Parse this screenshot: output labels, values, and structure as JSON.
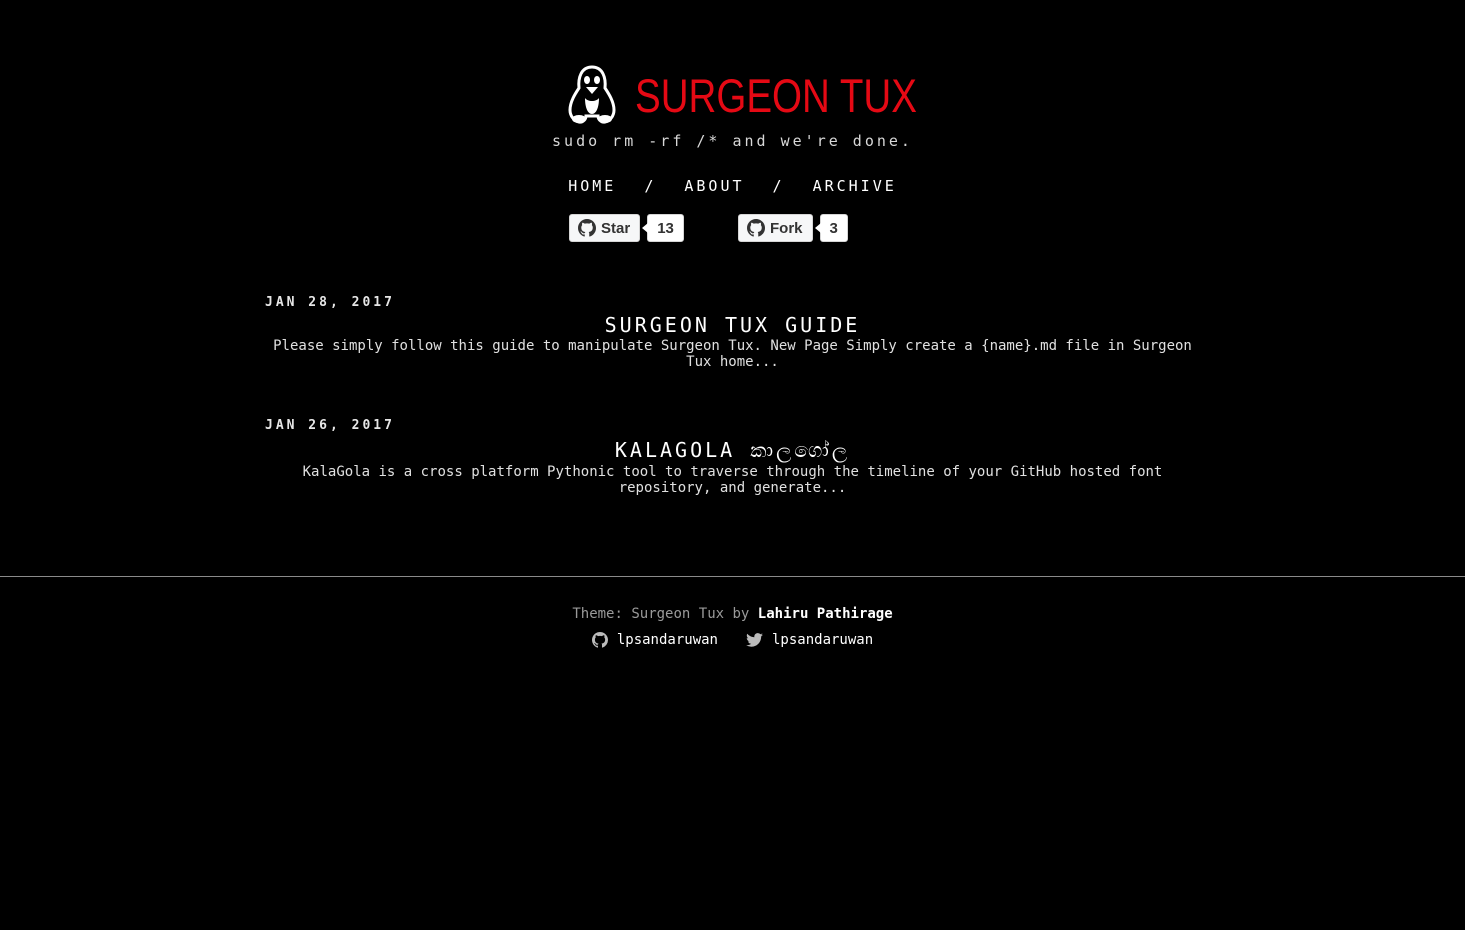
{
  "site": {
    "title": "SURGEON TUX",
    "tagline": "sudo rm -rf /* and we're done."
  },
  "nav": {
    "items": [
      {
        "label": "HOME"
      },
      {
        "label": "ABOUT"
      },
      {
        "label": "ARCHIVE"
      }
    ],
    "separator": "/"
  },
  "github_buttons": {
    "star": {
      "label": "Star",
      "count": "13"
    },
    "fork": {
      "label": "Fork",
      "count": "3"
    }
  },
  "posts": [
    {
      "date": "JAN 28, 2017",
      "title": "SURGEON TUX GUIDE",
      "excerpt": "Please simply follow this guide to manipulate Surgeon Tux. New Page Simply create a {name}.md file in Surgeon Tux home..."
    },
    {
      "date": "JAN 26, 2017",
      "title": "KALAGOLA කාලගෝල",
      "excerpt": "KalaGola is a cross platform Pythonic tool to traverse through the timeline of your GitHub hosted font repository, and generate..."
    }
  ],
  "footer": {
    "theme_text": "Theme: Surgeon Tux by",
    "author": "Lahiru Pathirage",
    "github_user": "lpsandaruwan",
    "twitter_user": "lpsandaruwan"
  },
  "colors": {
    "background": "#000000",
    "brand_red": "#e50914",
    "text": "#e6e6e6"
  },
  "icons": {
    "logo": "tux-penguin-icon",
    "star_button": "github-icon",
    "fork_button": "github-icon",
    "footer_github": "github-icon",
    "footer_twitter": "twitter-icon"
  }
}
